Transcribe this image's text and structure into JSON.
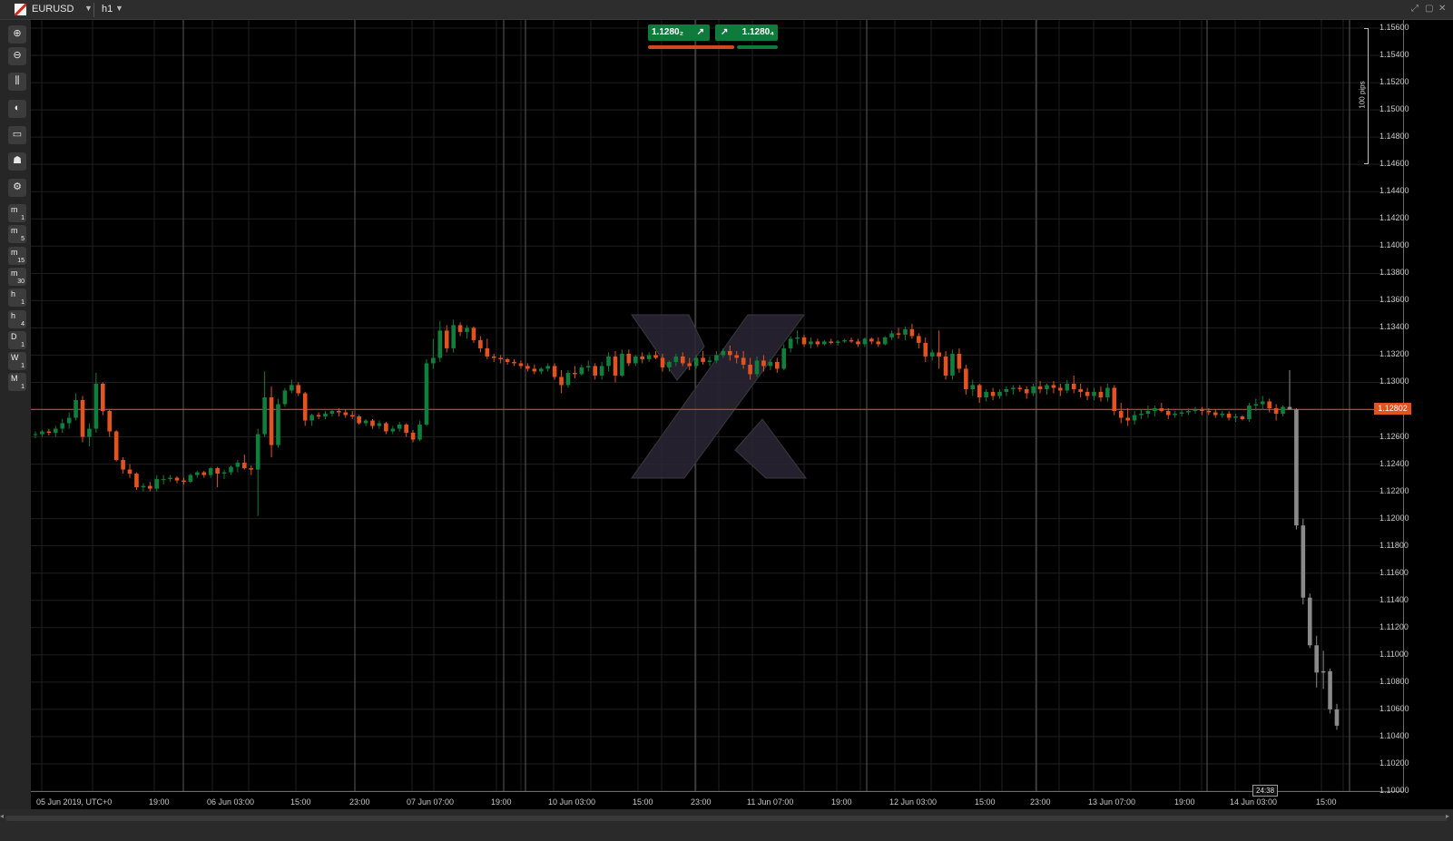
{
  "window": {
    "symbol": "EURUSD",
    "timeframe": "h1",
    "controls": [
      "⤢",
      "▢",
      "✕"
    ]
  },
  "toolbar": {
    "tools": [
      {
        "name": "zoom-in-icon",
        "glyph": "⊕"
      },
      {
        "name": "zoom-out-icon",
        "glyph": "⊖"
      },
      {
        "name": "chart-type-icon",
        "glyph": "⫼"
      },
      {
        "name": "color-theme-icon",
        "glyph": "◐"
      },
      {
        "name": "view-options-icon",
        "glyph": "▭"
      },
      {
        "name": "trader-icon",
        "glyph": "☗"
      },
      {
        "name": "chart-settings-icon",
        "glyph": "⚙"
      }
    ],
    "timeframes": [
      {
        "main": "m",
        "sub": "1"
      },
      {
        "main": "m",
        "sub": "5"
      },
      {
        "main": "m",
        "sub": "15"
      },
      {
        "main": "m",
        "sub": "30"
      },
      {
        "main": "h",
        "sub": "1"
      },
      {
        "main": "h",
        "sub": "4"
      },
      {
        "main": "D",
        "sub": "1"
      },
      {
        "main": "W",
        "sub": "1"
      },
      {
        "main": "M",
        "sub": "1"
      }
    ],
    "active_timeframe": "h1"
  },
  "quote": {
    "bid": "1.1280₂",
    "ask": "1.1280₄",
    "bid_arrow": "↗",
    "ask_arrow": "↗",
    "colors": {
      "buy": "#0e7a3c",
      "sell": "#d14a1e"
    }
  },
  "current_price": "1.12802",
  "countdown": "24:38",
  "pips_label": "100 pips",
  "colors": {
    "bull": "#0f7f3c",
    "bear": "#e35320",
    "pending": "#8a8a8a",
    "grid": "#1f1f1f",
    "session_line": "#5a5a5a",
    "price_line": "#e35320",
    "watermark": "#2a2636"
  },
  "chart_data": {
    "type": "candlestick",
    "title": "",
    "price_labels": [
      "1.15600",
      "1.15400",
      "1.15200",
      "1.15000",
      "1.14800",
      "1.14600",
      "1.14400",
      "1.14200",
      "1.14000",
      "1.13800",
      "1.13600",
      "1.13400",
      "1.13200",
      "1.13000",
      "1.12800",
      "1.12600",
      "1.12400",
      "1.12200",
      "1.12000",
      "1.11800",
      "1.11600",
      "1.11400",
      "1.11200",
      "1.11000",
      "1.10800",
      "1.10600",
      "1.10400",
      "1.10200",
      "1.10000"
    ],
    "time_labels": [
      "05 Jun 2019, UTC+0",
      "19:00",
      "06 Jun 03:00",
      "15:00",
      "23:00",
      "07 Jun 07:00",
      "19:00",
      "10 Jun 03:00",
      "15:00",
      "23:00",
      "11 Jun 07:00",
      "19:00",
      "12 Jun 03:00",
      "15:00",
      "23:00",
      "13 Jun 07:00",
      "19:00",
      "14 Jun 03:00",
      "15:00"
    ],
    "ylim": [
      1.1,
      1.1566
    ],
    "session_separators": [
      "06 Jun",
      "07 Jun",
      "08 Jun",
      "10 Jun",
      "11 Jun",
      "12 Jun",
      "13 Jun",
      "14 Jun",
      "15 Jun"
    ],
    "candles": [
      [
        1.12618,
        1.1264,
        1.1259,
        1.1262
      ],
      [
        1.1262,
        1.1265,
        1.126,
        1.1264
      ],
      [
        1.1264,
        1.1266,
        1.1261,
        1.1263
      ],
      [
        1.1263,
        1.1268,
        1.126,
        1.1266
      ],
      [
        1.1266,
        1.1273,
        1.1263,
        1.127
      ],
      [
        1.127,
        1.1278,
        1.1266,
        1.1274
      ],
      [
        1.1274,
        1.1292,
        1.1272,
        1.1287
      ],
      [
        1.1287,
        1.129,
        1.1256,
        1.126
      ],
      [
        1.126,
        1.127,
        1.1253,
        1.1266
      ],
      [
        1.1266,
        1.1307,
        1.1263,
        1.1299
      ],
      [
        1.1299,
        1.13,
        1.1276,
        1.1279
      ],
      [
        1.1279,
        1.128,
        1.126,
        1.1264
      ],
      [
        1.1264,
        1.1265,
        1.1242,
        1.1243
      ],
      [
        1.1243,
        1.1245,
        1.1233,
        1.1236
      ],
      [
        1.1236,
        1.124,
        1.123,
        1.1233
      ],
      [
        1.1233,
        1.1234,
        1.1221,
        1.1223
      ],
      [
        1.1223,
        1.1226,
        1.122,
        1.1224
      ],
      [
        1.1224,
        1.1227,
        1.122,
        1.1222
      ],
      [
        1.1222,
        1.1232,
        1.122,
        1.1229
      ],
      [
        1.1229,
        1.1232,
        1.1225,
        1.1229
      ],
      [
        1.1229,
        1.1232,
        1.1227,
        1.123
      ],
      [
        1.123,
        1.1231,
        1.1226,
        1.1228
      ],
      [
        1.1228,
        1.123,
        1.1225,
        1.1227
      ],
      [
        1.1227,
        1.1233,
        1.1226,
        1.1232
      ],
      [
        1.1232,
        1.1235,
        1.123,
        1.1234
      ],
      [
        1.1234,
        1.1235,
        1.123,
        1.1232
      ],
      [
        1.1232,
        1.1238,
        1.123,
        1.1237
      ],
      [
        1.1237,
        1.1238,
        1.1223,
        1.1233
      ],
      [
        1.1233,
        1.1236,
        1.1229,
        1.1234
      ],
      [
        1.1234,
        1.1239,
        1.1232,
        1.1238
      ],
      [
        1.1238,
        1.1243,
        1.1234,
        1.1241
      ],
      [
        1.1241,
        1.1247,
        1.1236,
        1.1237
      ],
      [
        1.1237,
        1.1239,
        1.1232,
        1.1236
      ],
      [
        1.1236,
        1.1266,
        1.1202,
        1.1262
      ],
      [
        1.1262,
        1.1308,
        1.126,
        1.1289
      ],
      [
        1.1289,
        1.1297,
        1.1245,
        1.1254
      ],
      [
        1.1254,
        1.1288,
        1.1252,
        1.1284
      ],
      [
        1.1284,
        1.1296,
        1.1282,
        1.1294
      ],
      [
        1.1294,
        1.1302,
        1.1292,
        1.1298
      ],
      [
        1.1298,
        1.13,
        1.129,
        1.1292
      ],
      [
        1.1292,
        1.1293,
        1.1268,
        1.1272
      ],
      [
        1.1272,
        1.1277,
        1.1268,
        1.1276
      ],
      [
        1.1276,
        1.1278,
        1.1273,
        1.1275
      ],
      [
        1.1275,
        1.1279,
        1.1273,
        1.1277
      ],
      [
        1.1277,
        1.128,
        1.1275,
        1.1279
      ],
      [
        1.1279,
        1.1281,
        1.1275,
        1.1278
      ],
      [
        1.1278,
        1.128,
        1.1274,
        1.1276
      ],
      [
        1.1276,
        1.1279,
        1.1273,
        1.1275
      ],
      [
        1.1275,
        1.1276,
        1.1269,
        1.127
      ],
      [
        1.127,
        1.1273,
        1.1268,
        1.1272
      ],
      [
        1.1272,
        1.1273,
        1.1266,
        1.1268
      ],
      [
        1.1268,
        1.1272,
        1.1266,
        1.127
      ],
      [
        1.127,
        1.1271,
        1.1262,
        1.1264
      ],
      [
        1.1264,
        1.1268,
        1.1262,
        1.1266
      ],
      [
        1.1266,
        1.1271,
        1.1264,
        1.1269
      ],
      [
        1.1269,
        1.127,
        1.126,
        1.1263
      ],
      [
        1.1263,
        1.1265,
        1.1256,
        1.1258
      ],
      [
        1.1258,
        1.1272,
        1.1257,
        1.1269
      ],
      [
        1.1269,
        1.1317,
        1.1268,
        1.1314
      ],
      [
        1.1314,
        1.1332,
        1.131,
        1.1318
      ],
      [
        1.1318,
        1.1345,
        1.1315,
        1.1338
      ],
      [
        1.1338,
        1.1342,
        1.1322,
        1.1325
      ],
      [
        1.1325,
        1.1346,
        1.1322,
        1.1342
      ],
      [
        1.1342,
        1.1344,
        1.1334,
        1.1337
      ],
      [
        1.1337,
        1.1342,
        1.1332,
        1.134
      ],
      [
        1.134,
        1.1341,
        1.1329,
        1.1331
      ],
      [
        1.1331,
        1.1334,
        1.1322,
        1.1325
      ],
      [
        1.1325,
        1.1332,
        1.1317,
        1.1319
      ],
      [
        1.1319,
        1.1321,
        1.1315,
        1.1318
      ],
      [
        1.1318,
        1.132,
        1.1314,
        1.1317
      ],
      [
        1.1317,
        1.1318,
        1.1313,
        1.1315
      ],
      [
        1.1315,
        1.1317,
        1.1312,
        1.1314
      ],
      [
        1.1314,
        1.1316,
        1.131,
        1.1312
      ],
      [
        1.1312,
        1.1314,
        1.1308,
        1.131
      ],
      [
        1.131,
        1.1313,
        1.1306,
        1.1308
      ],
      [
        1.1308,
        1.1311,
        1.1306,
        1.131
      ],
      [
        1.131,
        1.1314,
        1.1308,
        1.1312
      ],
      [
        1.1312,
        1.1314,
        1.1302,
        1.1304
      ],
      [
        1.1304,
        1.1309,
        1.1292,
        1.1298
      ],
      [
        1.1298,
        1.1309,
        1.1296,
        1.1307
      ],
      [
        1.1307,
        1.1312,
        1.1303,
        1.1306
      ],
      [
        1.1306,
        1.1313,
        1.1305,
        1.1311
      ],
      [
        1.1311,
        1.1316,
        1.1308,
        1.1312
      ],
      [
        1.1312,
        1.1314,
        1.1302,
        1.1305
      ],
      [
        1.1305,
        1.1315,
        1.1302,
        1.1312
      ],
      [
        1.1312,
        1.1322,
        1.1308,
        1.1319
      ],
      [
        1.1319,
        1.1323,
        1.13,
        1.1305
      ],
      [
        1.1305,
        1.1324,
        1.1304,
        1.1321
      ],
      [
        1.1321,
        1.1324,
        1.1312,
        1.1314
      ],
      [
        1.1314,
        1.132,
        1.1312,
        1.1319
      ],
      [
        1.1319,
        1.1322,
        1.1314,
        1.1317
      ],
      [
        1.1317,
        1.1322,
        1.1315,
        1.132
      ],
      [
        1.132,
        1.1323,
        1.1317,
        1.1318
      ],
      [
        1.1318,
        1.1321,
        1.1308,
        1.1311
      ],
      [
        1.1311,
        1.1316,
        1.1308,
        1.1315
      ],
      [
        1.1315,
        1.1321,
        1.1312,
        1.1319
      ],
      [
        1.1319,
        1.1322,
        1.1312,
        1.1314
      ],
      [
        1.1314,
        1.1318,
        1.1309,
        1.1312
      ],
      [
        1.1312,
        1.132,
        1.131,
        1.1318
      ],
      [
        1.1318,
        1.1323,
        1.1313,
        1.1315
      ],
      [
        1.1315,
        1.1319,
        1.1312,
        1.1316
      ],
      [
        1.1316,
        1.1323,
        1.1314,
        1.132
      ],
      [
        1.132,
        1.1325,
        1.1318,
        1.1323
      ],
      [
        1.1323,
        1.1327,
        1.1316,
        1.132
      ],
      [
        1.132,
        1.1323,
        1.1314,
        1.1318
      ],
      [
        1.1318,
        1.1323,
        1.131,
        1.1313
      ],
      [
        1.1313,
        1.1318,
        1.1302,
        1.1306
      ],
      [
        1.1306,
        1.1319,
        1.1304,
        1.1316
      ],
      [
        1.1316,
        1.132,
        1.1308,
        1.1312
      ],
      [
        1.1312,
        1.1317,
        1.1309,
        1.1315
      ],
      [
        1.1315,
        1.1318,
        1.1307,
        1.131
      ],
      [
        1.131,
        1.1328,
        1.1309,
        1.1325
      ],
      [
        1.1325,
        1.1334,
        1.1322,
        1.1332
      ],
      [
        1.1332,
        1.1338,
        1.1328,
        1.1333
      ],
      [
        1.1333,
        1.1335,
        1.1326,
        1.1328
      ],
      [
        1.1328,
        1.1333,
        1.1325,
        1.133
      ],
      [
        1.133,
        1.1332,
        1.1326,
        1.1328
      ],
      [
        1.1328,
        1.1331,
        1.1327,
        1.133
      ],
      [
        1.133,
        1.1332,
        1.1328,
        1.1329
      ],
      [
        1.1329,
        1.1331,
        1.1327,
        1.133
      ],
      [
        1.133,
        1.1332,
        1.1329,
        1.1331
      ],
      [
        1.1331,
        1.1333,
        1.1329,
        1.133
      ],
      [
        1.133,
        1.1332,
        1.1326,
        1.1328
      ],
      [
        1.1328,
        1.1333,
        1.1326,
        1.1332
      ],
      [
        1.1332,
        1.1333,
        1.1328,
        1.133
      ],
      [
        1.133,
        1.1333,
        1.1326,
        1.1328
      ],
      [
        1.1328,
        1.1334,
        1.1327,
        1.1333
      ],
      [
        1.1333,
        1.1338,
        1.1331,
        1.1336
      ],
      [
        1.1336,
        1.134,
        1.1332,
        1.1335
      ],
      [
        1.1335,
        1.1341,
        1.1331,
        1.1339
      ],
      [
        1.1339,
        1.1343,
        1.1332,
        1.1334
      ],
      [
        1.1334,
        1.1336,
        1.1325,
        1.1329
      ],
      [
        1.1329,
        1.1333,
        1.1315,
        1.1319
      ],
      [
        1.1319,
        1.1324,
        1.1316,
        1.1322
      ],
      [
        1.1322,
        1.1338,
        1.131,
        1.1319
      ],
      [
        1.1319,
        1.1323,
        1.1302,
        1.1305
      ],
      [
        1.1305,
        1.1324,
        1.1302,
        1.1321
      ],
      [
        1.1321,
        1.1325,
        1.1307,
        1.131
      ],
      [
        1.131,
        1.1313,
        1.1291,
        1.1295
      ],
      [
        1.1295,
        1.1302,
        1.129,
        1.1298
      ],
      [
        1.1298,
        1.1299,
        1.1285,
        1.1289
      ],
      [
        1.1289,
        1.1295,
        1.1286,
        1.1293
      ],
      [
        1.1293,
        1.1296,
        1.1287,
        1.129
      ],
      [
        1.129,
        1.1295,
        1.1288,
        1.1293
      ],
      [
        1.1293,
        1.1297,
        1.129,
        1.1295
      ],
      [
        1.1295,
        1.1298,
        1.1291,
        1.1296
      ],
      [
        1.1296,
        1.1298,
        1.1293,
        1.1295
      ],
      [
        1.1295,
        1.1297,
        1.1288,
        1.1292
      ],
      [
        1.1292,
        1.1299,
        1.129,
        1.1297
      ],
      [
        1.1297,
        1.1301,
        1.1292,
        1.1295
      ],
      [
        1.1295,
        1.1299,
        1.1291,
        1.1298
      ],
      [
        1.1298,
        1.1301,
        1.1292,
        1.1296
      ],
      [
        1.1296,
        1.1299,
        1.129,
        1.1294
      ],
      [
        1.1294,
        1.1302,
        1.1292,
        1.1299
      ],
      [
        1.1299,
        1.1305,
        1.1292,
        1.1295
      ],
      [
        1.1295,
        1.1299,
        1.1289,
        1.1293
      ],
      [
        1.1293,
        1.1296,
        1.1287,
        1.129
      ],
      [
        1.129,
        1.1296,
        1.1287,
        1.1293
      ],
      [
        1.1293,
        1.1297,
        1.1286,
        1.1289
      ],
      [
        1.1289,
        1.1299,
        1.1286,
        1.1296
      ],
      [
        1.1296,
        1.1298,
        1.1276,
        1.1279
      ],
      [
        1.1279,
        1.1285,
        1.127,
        1.1274
      ],
      [
        1.1274,
        1.1281,
        1.1268,
        1.1272
      ],
      [
        1.1272,
        1.1279,
        1.1269,
        1.1276
      ],
      [
        1.1276,
        1.128,
        1.1273,
        1.1277
      ],
      [
        1.1277,
        1.1283,
        1.1274,
        1.1279
      ],
      [
        1.1279,
        1.1283,
        1.1275,
        1.1281
      ],
      [
        1.1281,
        1.1285,
        1.1278,
        1.1279
      ],
      [
        1.1279,
        1.1281,
        1.1273,
        1.1276
      ],
      [
        1.1276,
        1.1279,
        1.1274,
        1.1277
      ],
      [
        1.1277,
        1.128,
        1.1275,
        1.1278
      ],
      [
        1.1278,
        1.1281,
        1.1276,
        1.1279
      ],
      [
        1.1279,
        1.1282,
        1.1277,
        1.128
      ],
      [
        1.128,
        1.1282,
        1.1276,
        1.1279
      ],
      [
        1.1279,
        1.1281,
        1.1276,
        1.1278
      ],
      [
        1.1278,
        1.128,
        1.1274,
        1.1276
      ],
      [
        1.1276,
        1.1279,
        1.1274,
        1.1277
      ],
      [
        1.1277,
        1.1279,
        1.1272,
        1.1274
      ],
      [
        1.1274,
        1.1277,
        1.1271,
        1.1275
      ],
      [
        1.1275,
        1.1276,
        1.1272,
        1.1273
      ],
      [
        1.1273,
        1.1285,
        1.1271,
        1.1283
      ],
      [
        1.1283,
        1.1288,
        1.1279,
        1.1284
      ],
      [
        1.1284,
        1.129,
        1.128,
        1.1286
      ],
      [
        1.1286,
        1.1288,
        1.1278,
        1.1281
      ],
      [
        1.1281,
        1.1284,
        1.1272,
        1.1277
      ],
      [
        1.1277,
        1.1283,
        1.1275,
        1.1282
      ],
      [
        1.1282,
        1.1309,
        1.128,
        1.128
      ],
      [
        1.128,
        1.1281,
        1.1192,
        1.1195
      ],
      [
        1.1195,
        1.12,
        1.1137,
        1.1142
      ],
      [
        1.1142,
        1.1145,
        1.1105,
        1.1107
      ],
      [
        1.1107,
        1.1114,
        1.1076,
        1.1087
      ],
      [
        1.1087,
        1.1103,
        1.1075,
        1.1088
      ],
      [
        1.1088,
        1.109,
        1.1057,
        1.106
      ],
      [
        1.106,
        1.1064,
        1.1045,
        1.1048
      ]
    ]
  }
}
